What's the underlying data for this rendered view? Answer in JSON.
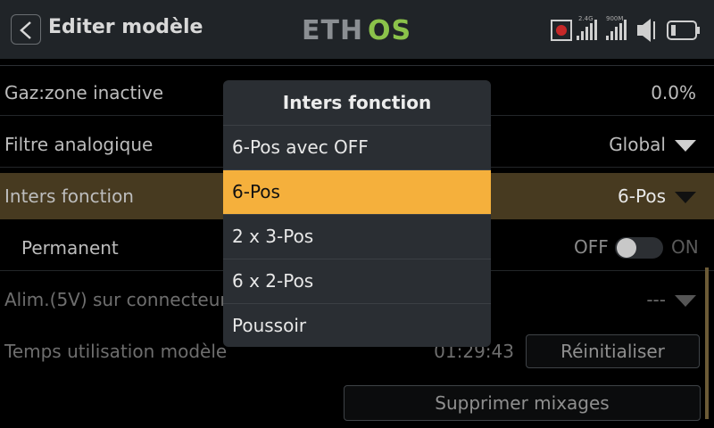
{
  "header": {
    "title": "Editer modèle",
    "logo": "ETHOS",
    "status_icons": [
      "recording-icon",
      "signal-2.4g-icon",
      "signal-900m-icon",
      "volume-icon",
      "battery-icon"
    ],
    "signal_2_4g_label": "2.4G",
    "signal_900m_label": "900M"
  },
  "rows": [
    {
      "label": "Gaz:zone inactive",
      "value": "0.0%"
    },
    {
      "label": "Filtre analogique",
      "value": "Global"
    },
    {
      "label": "Inters fonction",
      "value": "6-Pos"
    },
    {
      "label": "Permanent",
      "off": "OFF",
      "on": "ON"
    },
    {
      "label": "Alim.(5V) sur connecteur",
      "value": "---"
    },
    {
      "label": "Temps utilisation modèle",
      "value": "01:29:43",
      "button": "Réinitialiser"
    }
  ],
  "delete_mixes_button": "Supprimer mixages",
  "popup": {
    "title": "Inters fonction",
    "options": [
      "6-Pos avec OFF",
      "6-Pos",
      "2 x 3-Pos",
      "6 x 2-Pos",
      "Poussoir"
    ],
    "selected_index": 1
  },
  "colors": {
    "accent": "#f5b03c",
    "logo_green": "#8bc34a",
    "header_bg": "#202428"
  }
}
